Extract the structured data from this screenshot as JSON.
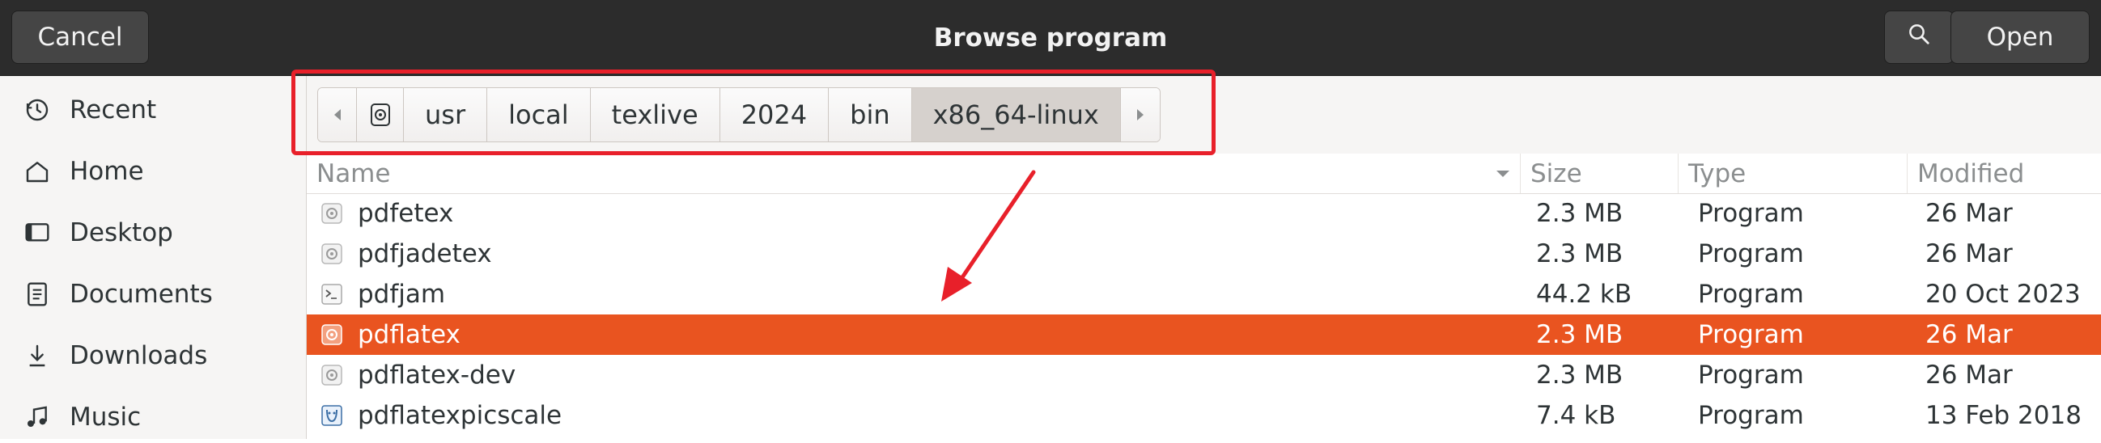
{
  "header": {
    "title": "Browse program",
    "cancel_label": "Cancel",
    "open_label": "Open",
    "search_icon": "search-icon"
  },
  "sidebar": {
    "items": [
      {
        "label": "Recent",
        "icon": "clock-icon"
      },
      {
        "label": "Home",
        "icon": "home-icon"
      },
      {
        "label": "Desktop",
        "icon": "desktop-icon"
      },
      {
        "label": "Documents",
        "icon": "document-icon"
      },
      {
        "label": "Downloads",
        "icon": "download-icon"
      },
      {
        "label": "Music",
        "icon": "music-icon"
      }
    ]
  },
  "pathbar": {
    "segments": [
      "usr",
      "local",
      "texlive",
      "2024",
      "bin",
      "x86_64-linux"
    ],
    "active": "x86_64-linux"
  },
  "columns": {
    "name": "Name",
    "size": "Size",
    "type": "Type",
    "modified": "Modified"
  },
  "files": [
    {
      "name": "pdfetex",
      "size": "2.3 MB",
      "type": "Program",
      "modified": "26 Mar",
      "icon": "executable-icon"
    },
    {
      "name": "pdfjadetex",
      "size": "2.3 MB",
      "type": "Program",
      "modified": "26 Mar",
      "icon": "executable-icon"
    },
    {
      "name": "pdfjam",
      "size": "44.2 kB",
      "type": "Program",
      "modified": "20 Oct 2023",
      "icon": "script-icon"
    },
    {
      "name": "pdflatex",
      "size": "2.3 MB",
      "type": "Program",
      "modified": "26 Mar",
      "icon": "executable-icon",
      "selected": true
    },
    {
      "name": "pdflatex-dev",
      "size": "2.3 MB",
      "type": "Program",
      "modified": "26 Mar",
      "icon": "executable-icon"
    },
    {
      "name": "pdflatexpicscale",
      "size": "7.4 kB",
      "type": "Program",
      "modified": "13 Feb 2018",
      "icon": "perl-script-icon"
    }
  ],
  "colors": {
    "selection": "#e95420",
    "annotation": "#e8202a"
  }
}
